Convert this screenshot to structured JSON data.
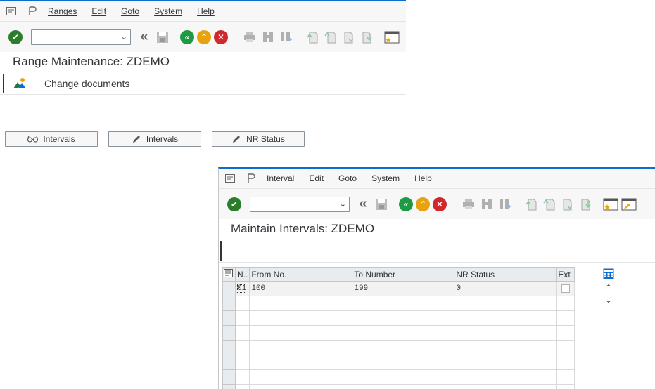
{
  "window1": {
    "menu": [
      "Ranges",
      "Edit",
      "Goto",
      "System",
      "Help"
    ],
    "title": "Range Maintenance: ZDEMO",
    "change_documents": "Change documents",
    "buttons": {
      "intervals_display": "Intervals",
      "intervals_change": "Intervals",
      "nr_status": "NR Status"
    }
  },
  "window2": {
    "menu": [
      "Interval",
      "Edit",
      "Goto",
      "System",
      "Help"
    ],
    "title": "Maintain Intervals: ZDEMO",
    "table": {
      "columns": [
        "N..",
        "From No.",
        "To Number",
        "NR Status",
        "Ext"
      ],
      "rows": [
        {
          "no": "01",
          "from": "100",
          "to": "199",
          "status": "0",
          "ext": false
        }
      ]
    }
  },
  "colors": {
    "accent": "#0a6ed1",
    "ok_green": "#2b7d2b",
    "back_green": "#1f9a44",
    "exit_orange": "#e8a20b",
    "cancel_red": "#d0292c"
  }
}
